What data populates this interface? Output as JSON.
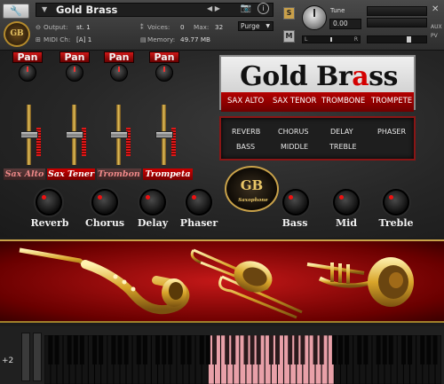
{
  "header": {
    "instrument_name": "Gold Brass",
    "output_label": "Output:",
    "output_value": "st. 1",
    "voices_label": "Voices:",
    "voices_value": "0",
    "max_label": "Max:",
    "max_value": "32",
    "purge_label": "Purge",
    "midi_label": "MIDI Ch:",
    "midi_value": "[A] 1",
    "memory_label": "Memory:",
    "memory_value": "49.77 MB",
    "solo_label": "S",
    "mute_label": "M",
    "tune_label": "Tune",
    "tune_value": "0.00",
    "pan_left": "L",
    "pan_right": "R",
    "aux_label": "AUX",
    "pv_label": "PV"
  },
  "pan_label": "Pan",
  "channels": [
    "Sax Alto",
    "Sax Tener",
    "Trombon",
    "Trompeta"
  ],
  "title": {
    "text": "Gold Brass",
    "highlight_letter": "a"
  },
  "sections": [
    "SAX ALTO",
    "SAX TENOR",
    "TROMBONE",
    "TROMPETE"
  ],
  "fx_labels": [
    "REVERB",
    "CHORUS",
    "DELAY",
    "PHASER",
    "BASS",
    "MIDDLE",
    "TREBLE"
  ],
  "seal": {
    "letters": "GB",
    "script": "Saxophone"
  },
  "knobs": [
    "Reverb",
    "Chorus",
    "Delay",
    "Phaser",
    "Bass",
    "Mid",
    "Treble"
  ],
  "keyboard": {
    "octave_label": "+2",
    "highlight_color": "#e8a0a8"
  },
  "colors": {
    "accent_red": "#c40000",
    "gold": "#c9a24a"
  }
}
